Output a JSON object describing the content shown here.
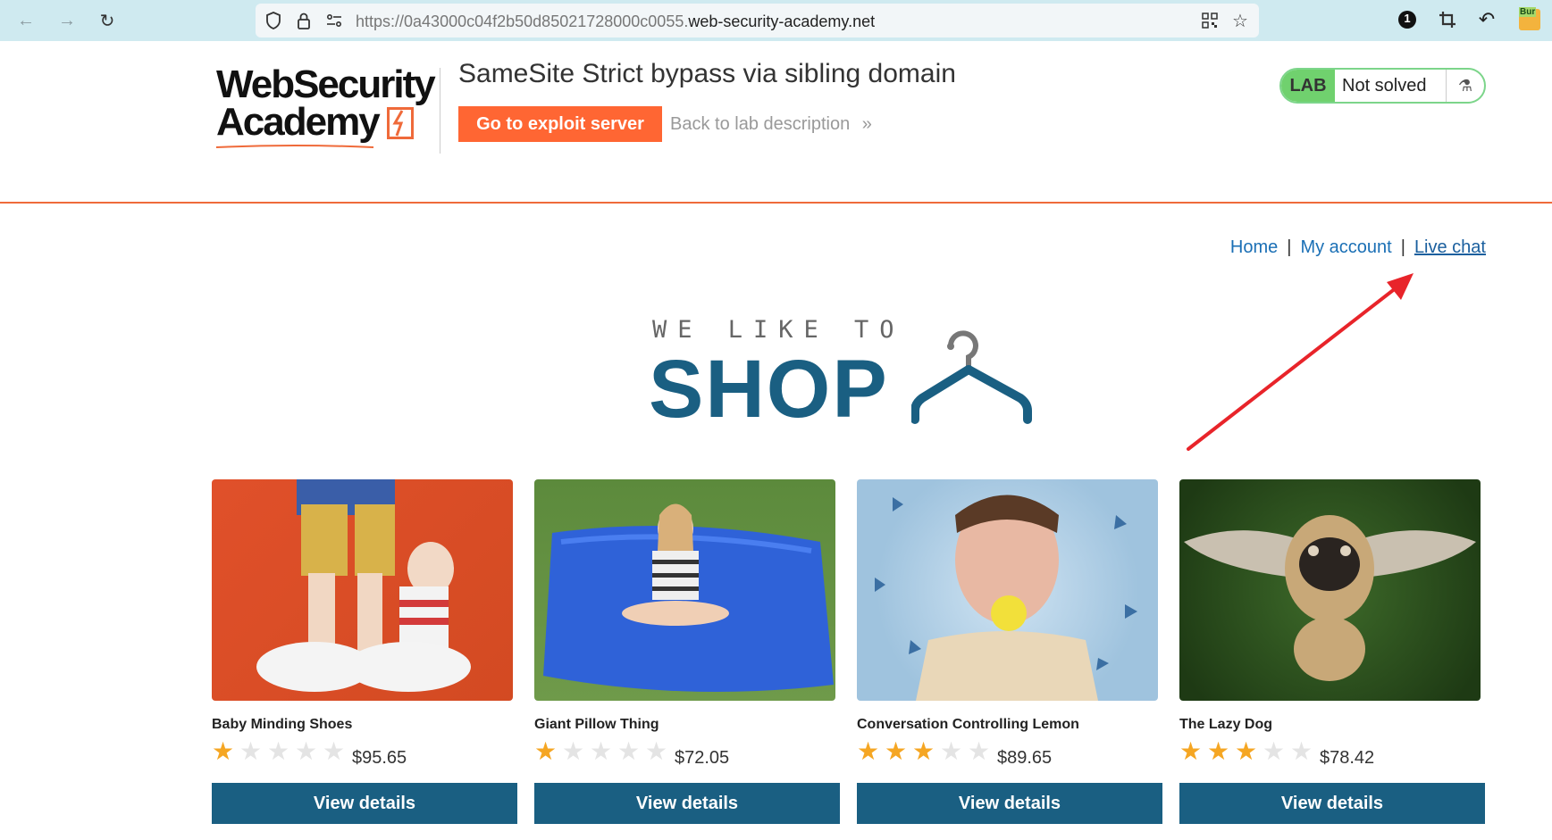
{
  "browser": {
    "url_prefix": "https://0a43000c04f2b50d85021728000c0055.",
    "url_host": "web-security-academy.net",
    "badge_count": "1",
    "ext_label": "Bur"
  },
  "lab": {
    "logo_line1": "WebSecurity",
    "logo_line2": "Academy",
    "title": "SameSite Strict bypass via sibling domain",
    "exploit_button": "Go to exploit server",
    "back_link": "Back to lab description",
    "back_chevrons": "»",
    "badge": "LAB",
    "status": "Not solved",
    "flask_icon": "⚗"
  },
  "nav": {
    "home": "Home",
    "sep1": "|",
    "my_account": "My account",
    "sep2": "|",
    "live_chat": "Live chat"
  },
  "banner": {
    "small": "WE LIKE TO",
    "big": "SHOP"
  },
  "products": [
    {
      "name": "Baby Minding Shoes",
      "rating": 1,
      "price": "$95.65",
      "button": "View details"
    },
    {
      "name": "Giant Pillow Thing",
      "rating": 1,
      "price": "$72.05",
      "button": "View details"
    },
    {
      "name": "Conversation Controlling Lemon",
      "rating": 3,
      "price": "$89.65",
      "button": "View details"
    },
    {
      "name": "The Lazy Dog",
      "rating": 3,
      "price": "$78.42",
      "button": "View details"
    }
  ],
  "colors": {
    "accent": "#ff6633",
    "primary": "#1a5f82",
    "link": "#1a6fb5",
    "star": "#f5a623",
    "annotation": "#e8242a"
  }
}
